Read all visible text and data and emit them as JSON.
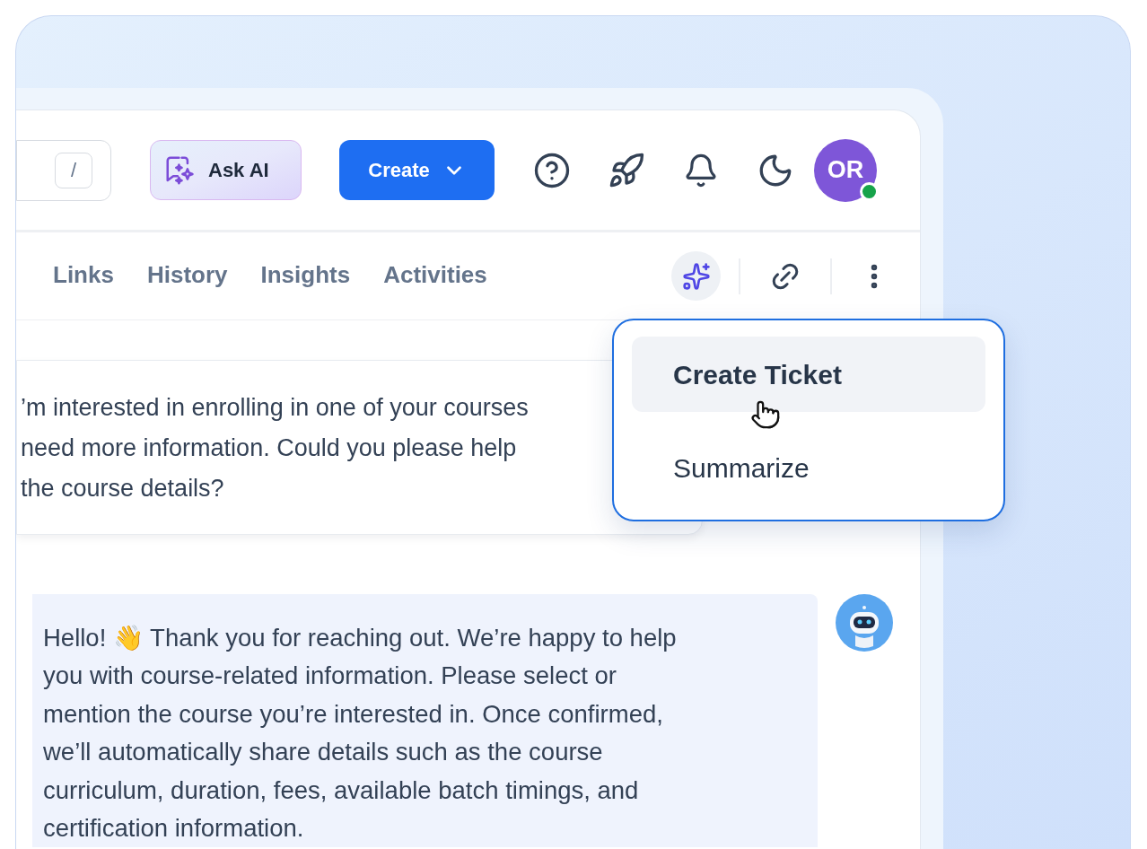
{
  "search": {
    "shortcut": "/"
  },
  "toolbar": {
    "ask_ai": "Ask AI",
    "create": "Create"
  },
  "user": {
    "initials": "OR",
    "online": true
  },
  "tabs": [
    {
      "label": "Links",
      "selected": false
    },
    {
      "label": "History",
      "selected": false
    },
    {
      "label": "Insights",
      "selected": false
    },
    {
      "label": "Activities",
      "selected": false
    }
  ],
  "menu": {
    "items": [
      {
        "label": "Create Ticket",
        "selected": true
      },
      {
        "label": "Summarize",
        "selected": false
      }
    ]
  },
  "messages": [
    {
      "kind": "user",
      "lines": [
        "’m interested in enrolling in one of your courses",
        "need more information. Could you please help",
        "the course details?"
      ]
    },
    {
      "kind": "bot",
      "lines": [
        "Hello! 👋 Thank you for reaching out. We’re happy to help",
        "you with course-related information. Please select or",
        "mention the course you’re interested in. Once confirmed,",
        "we’ll automatically share details such as the course",
        "curriculum, duration, fees, available batch timings, and",
        "certification information."
      ]
    }
  ]
}
